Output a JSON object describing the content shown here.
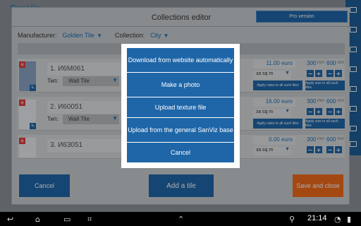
{
  "app": {
    "logo_text": "SanViz"
  },
  "dialog": {
    "title": "Collections editor",
    "pro_label": "Pro version",
    "manufacturer_label": "Manufacturer:",
    "manufacturer_value": "Golden Tile",
    "collection_label": "Collection:",
    "collection_value": "City"
  },
  "tiles": [
    {
      "name": "1. И6М061",
      "type_label": "Тип:",
      "type_value": "Wall Tile",
      "price": "11.00 euro",
      "units": "за sq m",
      "width": "300",
      "height": "600",
      "mm": "mm",
      "apply_rates": "Apply rates to all such tiles",
      "apply_size": "Apply size to all such tiles"
    },
    {
      "name": "2. И60051",
      "type_label": "Тип:",
      "type_value": "Wall Tile",
      "price": "16.00 euro",
      "units": "за sq m",
      "width": "300",
      "height": "600",
      "mm": "mm",
      "apply_rates": "Apply rates to all such tiles",
      "apply_size": "Apply size to all such tiles"
    },
    {
      "name": "3. И63051",
      "price": "0.00 euro",
      "units": "за sq m",
      "width": "300",
      "height": "600",
      "mm": "mm"
    }
  ],
  "footer": {
    "cancel_label": "Cancel",
    "add_tile_label": "Add a tile",
    "save_close_label": "Save and close"
  },
  "popup_menu": {
    "items": [
      "Download from website automatically",
      "Make a photo",
      "Upload texture file",
      "Upload from the general SanViz base",
      "Cancel"
    ]
  },
  "system_bar": {
    "time": "21:14"
  },
  "colors": {
    "accent": "#1f66a8",
    "save": "#f26a1b",
    "danger": "#e23c3c"
  },
  "icons": [
    "back-icon",
    "home-icon",
    "recent-apps-icon",
    "screenshot-icon",
    "chevron-up-icon",
    "usb-icon",
    "wifi-icon",
    "battery-icon",
    "delete-icon",
    "edit-icon",
    "plus-icon",
    "minus-icon"
  ]
}
